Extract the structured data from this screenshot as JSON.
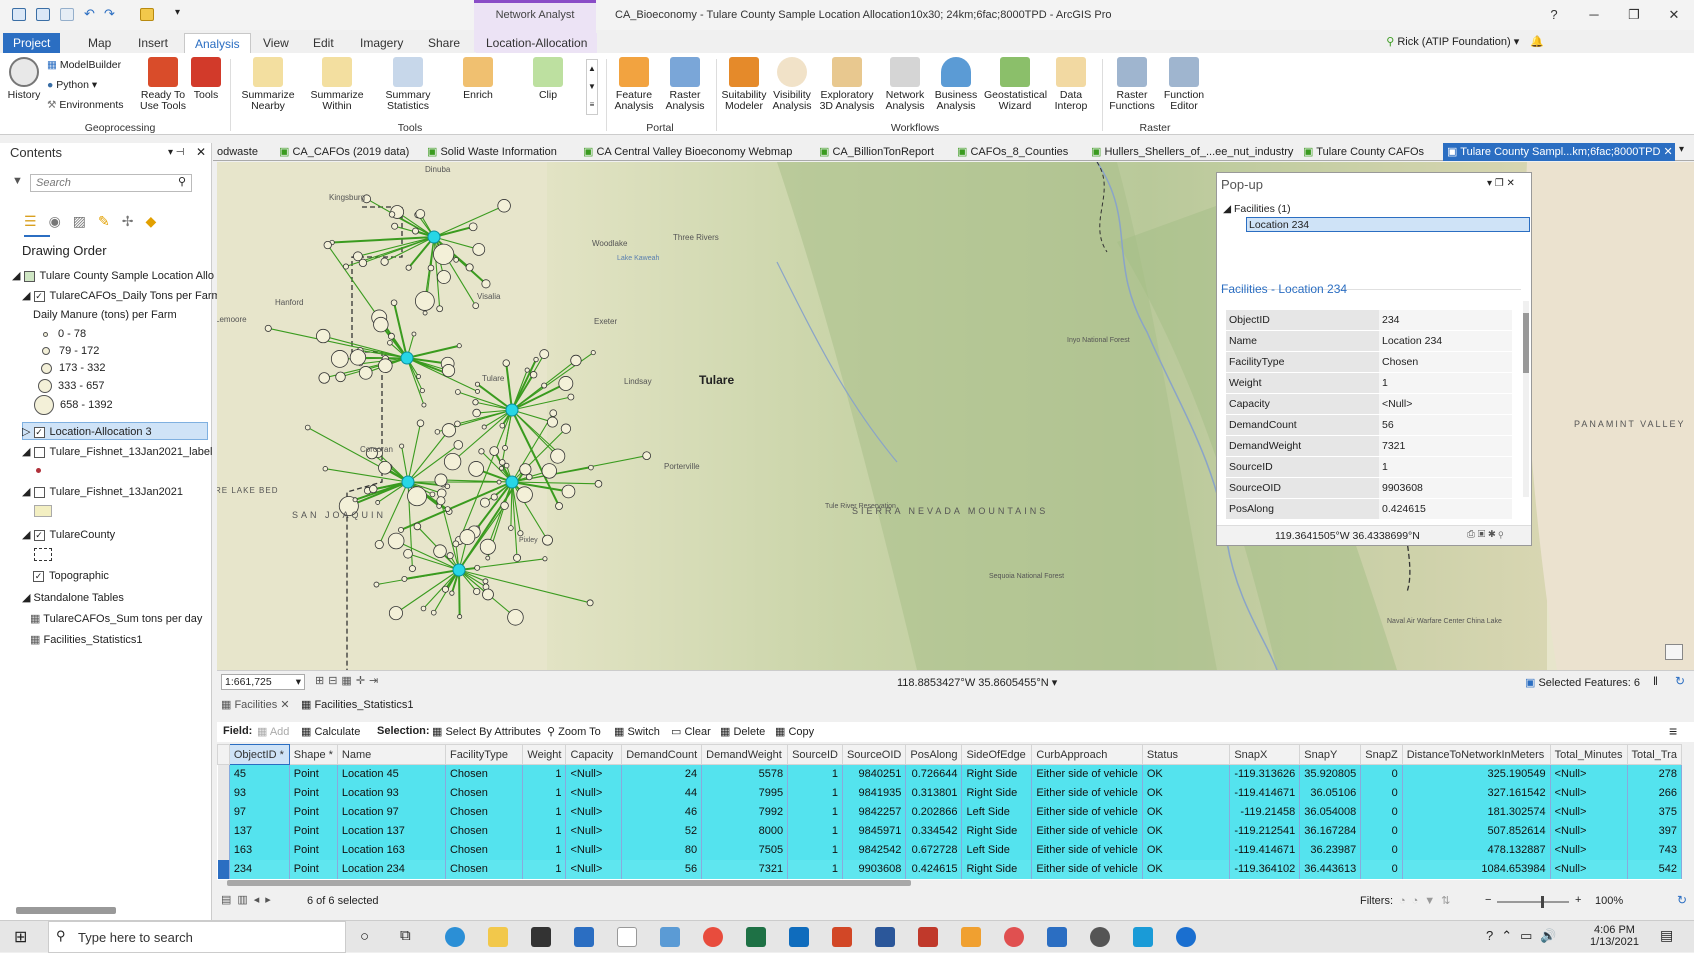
{
  "window": {
    "title": "CA_Bioeconomy - Tulare County Sample Location Allocation10x30; 24km;6fac;8000TPD - ArcGIS Pro",
    "context_group": "Network Analyst",
    "user": "Rick (ATIP Foundation)"
  },
  "ribbon_tabs": [
    "Project",
    "Map",
    "Insert",
    "Analysis",
    "View",
    "Edit",
    "Imagery",
    "Share",
    "Location-Allocation"
  ],
  "active_tab": "Analysis",
  "ribbon": {
    "history": "History",
    "modelbuilder": "ModelBuilder",
    "python": "Python",
    "environments": "Environments",
    "ready_to_use": "Ready To Use Tools",
    "tools": "Tools",
    "summarize_nearby": "Summarize Nearby",
    "summarize_within": "Summarize Within",
    "summary_statistics": "Summary Statistics",
    "enrich": "Enrich",
    "clip": "Clip",
    "feature_analysis": "Feature Analysis",
    "raster_analysis": "Raster Analysis",
    "suitability_modeler": "Suitability Modeler",
    "visibility_analysis": "Visibility Analysis",
    "exploratory_3d": "Exploratory 3D Analysis",
    "network_analysis": "Network Analysis",
    "business_analysis": "Business Analysis",
    "geostatistical_wizard": "Geostatistical Wizard",
    "data_interop": "Data Interop",
    "raster_functions": "Raster Functions",
    "function_editor": "Function Editor",
    "groups": {
      "geoprocessing": "Geoprocessing",
      "tools": "Tools",
      "portal": "Portal",
      "workflows": "Workflows",
      "raster": "Raster"
    }
  },
  "contents": {
    "title": "Contents",
    "search_placeholder": "Search",
    "drawing_order": "Drawing Order",
    "map_name": "Tulare County  Sample Location Allo",
    "layer1": "TulareCAFOs_Daily Tons per Farm",
    "legend_title": "Daily Manure (tons) per Farm",
    "legend": [
      "0 - 78",
      "79 - 172",
      "173 - 332",
      "333 - 657",
      "658 - 1392"
    ],
    "layer2": "Location-Allocation 3",
    "layer3": "Tulare_Fishnet_13Jan2021_label",
    "layer4": "Tulare_Fishnet_13Jan2021",
    "layer5": "TulareCounty",
    "layer6": "Topographic",
    "standalone": "Standalone Tables",
    "table1": "TulareCAFOs_Sum tons per day",
    "table2": "Facilities_Statistics1"
  },
  "map_tabs": [
    "odwaste",
    "CA_CAFOs (2019 data)",
    "Solid Waste Information",
    "CA Central Valley Bioeconomy Webmap",
    "CA_BillionTonReport",
    "CAFOs_8_Counties",
    "Hullers_Shellers_of_...ee_nut_industry",
    "Tulare County CAFOs",
    "Tulare County Sampl...km;6fac;8000TPD"
  ],
  "map_labels": {
    "tulare_big": "Tulare",
    "dinuba": "Dinuba",
    "kingsburg": "Kingsburg",
    "three_rivers": "Three Rivers",
    "woodlake": "Woodlake",
    "lake_kaweah": "Lake Kaweah",
    "hanford": "Hanford",
    "visalia": "Visalia",
    "lemoore": "Lemoore",
    "exeter": "Exeter",
    "lindsay": "Lindsay",
    "tulare_small": "Tulare",
    "corcoran": "Corcoran",
    "porterville": "Porterville",
    "san_joaquin": "SAN JOAQUIN",
    "sierra": "SIERRA NEVADA MOUNTAINS",
    "tule_lake": "RE LAKE BED",
    "tule_river": "Tule River Reservation",
    "pixley": "Pixley",
    "sequoia": "Sequoia National Forest",
    "inyo": "Inyo National Forest",
    "panamint": "PANAMINT VALLEY",
    "china_lake": "Naval Air Warfare Center China Lake"
  },
  "popup": {
    "title": "Pop-up",
    "facilities": "Facilities  (1)",
    "selected": "Location 234",
    "section": "Facilities - Location 234",
    "coords": "119.3641505°W 36.4338699°N",
    "attrs": [
      [
        "ObjectID",
        "234"
      ],
      [
        "Name",
        "Location 234"
      ],
      [
        "FacilityType",
        "Chosen"
      ],
      [
        "Weight",
        "1"
      ],
      [
        "Capacity",
        "<Null>"
      ],
      [
        "DemandCount",
        "56"
      ],
      [
        "DemandWeight",
        "7321"
      ],
      [
        "SourceID",
        "1"
      ],
      [
        "SourceOID",
        "9903608"
      ],
      [
        "PosAlong",
        "0.424615"
      ]
    ]
  },
  "map_footer": {
    "scale": "1:661,725",
    "coords": "118.8853427°W 35.8605455°N",
    "selected": "Selected Features: 6"
  },
  "table_tabs": [
    "Facilities",
    "Facilities_Statistics1"
  ],
  "table_toolbar": {
    "field": "Field:",
    "add": "Add",
    "calculate": "Calculate",
    "selection": "Selection:",
    "select_by_attr": "Select By Attributes",
    "zoom_to": "Zoom To",
    "switch": "Switch",
    "clear": "Clear",
    "delete": "Delete",
    "copy": "Copy"
  },
  "table": {
    "columns": [
      "ObjectID *",
      "Shape *",
      "Name",
      "FacilityType",
      "Weight",
      "Capacity",
      "DemandCount",
      "DemandWeight",
      "SourceID",
      "SourceOID",
      "PosAlong",
      "SideOfEdge",
      "CurbApproach",
      "Status",
      "SnapX",
      "SnapY",
      "SnapZ",
      "DistanceToNetworkInMeters",
      "Total_Minutes",
      "Total_Tra"
    ],
    "rows": [
      [
        "45",
        "Point",
        "Location 45",
        "Chosen",
        "1",
        "<Null>",
        "24",
        "5578",
        "1",
        "9840251",
        "0.726644",
        "Right Side",
        "Either side of vehicle",
        "OK",
        "-119.313626",
        "35.920805",
        "0",
        "325.190549",
        "<Null>",
        "278"
      ],
      [
        "93",
        "Point",
        "Location 93",
        "Chosen",
        "1",
        "<Null>",
        "44",
        "7995",
        "1",
        "9841935",
        "0.313801",
        "Right Side",
        "Either side of vehicle",
        "OK",
        "-119.414671",
        "36.05106",
        "0",
        "327.161542",
        "<Null>",
        "266"
      ],
      [
        "97",
        "Point",
        "Location 97",
        "Chosen",
        "1",
        "<Null>",
        "46",
        "7992",
        "1",
        "9842257",
        "0.202866",
        "Left Side",
        "Either side of vehicle",
        "OK",
        "-119.21458",
        "36.054008",
        "0",
        "181.302574",
        "<Null>",
        "375"
      ],
      [
        "137",
        "Point",
        "Location 137",
        "Chosen",
        "1",
        "<Null>",
        "52",
        "8000",
        "1",
        "9845971",
        "0.334542",
        "Right Side",
        "Either side of vehicle",
        "OK",
        "-119.212541",
        "36.167284",
        "0",
        "507.852614",
        "<Null>",
        "397"
      ],
      [
        "163",
        "Point",
        "Location 163",
        "Chosen",
        "1",
        "<Null>",
        "80",
        "7505",
        "1",
        "9842542",
        "0.672728",
        "Left Side",
        "Either side of vehicle",
        "OK",
        "-119.414671",
        "36.23987",
        "0",
        "478.132887",
        "<Null>",
        "743"
      ],
      [
        "234",
        "Point",
        "Location 234",
        "Chosen",
        "1",
        "<Null>",
        "56",
        "7321",
        "1",
        "9903608",
        "0.424615",
        "Right Side",
        "Either side of vehicle",
        "OK",
        "-119.364102",
        "36.443613",
        "0",
        "1084.653984",
        "<Null>",
        "542"
      ]
    ]
  },
  "table_footer": {
    "selected": "6 of 6 selected",
    "filters": "Filters:",
    "zoom": "100%"
  },
  "taskbar": {
    "search": "Type here to search",
    "time": "4:06 PM",
    "date": "1/13/2021"
  },
  "colors": {
    "accent": "#2b6ec2",
    "selected_row": "#54e3ee",
    "facility": "#27d6e6",
    "lines": "#3a9b1f"
  }
}
